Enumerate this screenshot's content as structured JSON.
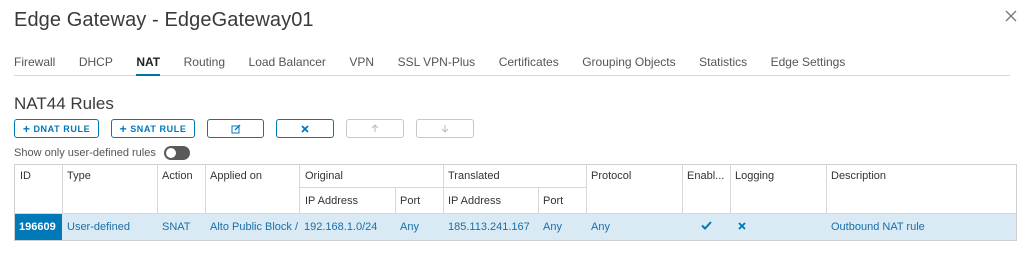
{
  "window": {
    "title": "Edge Gateway - EdgeGateway01"
  },
  "tabs": [
    {
      "label": "Firewall"
    },
    {
      "label": "DHCP"
    },
    {
      "label": "NAT",
      "active": true
    },
    {
      "label": "Routing"
    },
    {
      "label": "Load Balancer"
    },
    {
      "label": "VPN"
    },
    {
      "label": "SSL VPN-Plus"
    },
    {
      "label": "Certificates"
    },
    {
      "label": "Grouping Objects"
    },
    {
      "label": "Statistics"
    },
    {
      "label": "Edge Settings"
    }
  ],
  "section": {
    "title": "NAT44 Rules"
  },
  "toolbar": {
    "dnat_label": "DNAT RULE",
    "snat_label": "SNAT RULE",
    "edit_icon": "edit-icon",
    "delete_icon": "x-icon",
    "move_up_icon": "arrow-up-icon",
    "move_down_icon": "arrow-down-icon",
    "accent_color": "#0079b8"
  },
  "filter": {
    "label": "Show only user-defined rules",
    "enabled": false
  },
  "table": {
    "headers": {
      "id": "ID",
      "type": "Type",
      "action": "Action",
      "applied_on": "Applied on",
      "original": "Original",
      "translated": "Translated",
      "protocol": "Protocol",
      "enabled": "Enabl...",
      "logging": "Logging",
      "description": "Description",
      "orig_ip": "IP Address",
      "orig_port": "Port",
      "trans_ip": "IP Address",
      "trans_port": "Port"
    },
    "rows": [
      {
        "id": "196609",
        "type": "User-defined",
        "action": "SNAT",
        "applied_on": "Alto Public Block /",
        "orig_ip": "192.168.1.0/24",
        "orig_port": "Any",
        "trans_ip": "185.113.241.167",
        "trans_port": "Any",
        "protocol": "Any",
        "enabled_icon": "checkmark-icon",
        "logging_icon": "x-icon",
        "description": "Outbound NAT rule"
      }
    ],
    "selected_row_color": "#d9eaf5",
    "id_highlight_color": "#0079b8"
  }
}
